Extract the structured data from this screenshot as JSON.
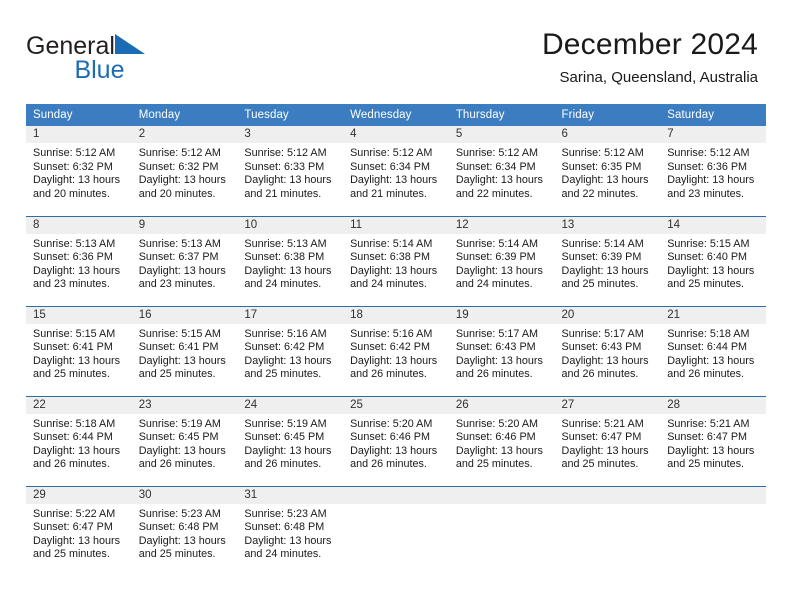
{
  "brand": {
    "name_part1": "General",
    "name_part2": "Blue",
    "flag_icon": "triangle-flag-icon"
  },
  "header": {
    "title": "December 2024",
    "location": "Sarina, Queensland, Australia"
  },
  "colors": {
    "header_blue": "#3b7dc0",
    "row_divider_blue": "#2e6da4",
    "daynum_band": "#efefef",
    "brand_blue": "#1c6cb5"
  },
  "calendar": {
    "weekday_headers": [
      "Sunday",
      "Monday",
      "Tuesday",
      "Wednesday",
      "Thursday",
      "Friday",
      "Saturday"
    ],
    "weeks": [
      [
        {
          "day": "1",
          "sunrise": "Sunrise: 5:12 AM",
          "sunset": "Sunset: 6:32 PM",
          "daylight_line1": "Daylight: 13 hours",
          "daylight_line2": "and 20 minutes."
        },
        {
          "day": "2",
          "sunrise": "Sunrise: 5:12 AM",
          "sunset": "Sunset: 6:32 PM",
          "daylight_line1": "Daylight: 13 hours",
          "daylight_line2": "and 20 minutes."
        },
        {
          "day": "3",
          "sunrise": "Sunrise: 5:12 AM",
          "sunset": "Sunset: 6:33 PM",
          "daylight_line1": "Daylight: 13 hours",
          "daylight_line2": "and 21 minutes."
        },
        {
          "day": "4",
          "sunrise": "Sunrise: 5:12 AM",
          "sunset": "Sunset: 6:34 PM",
          "daylight_line1": "Daylight: 13 hours",
          "daylight_line2": "and 21 minutes."
        },
        {
          "day": "5",
          "sunrise": "Sunrise: 5:12 AM",
          "sunset": "Sunset: 6:34 PM",
          "daylight_line1": "Daylight: 13 hours",
          "daylight_line2": "and 22 minutes."
        },
        {
          "day": "6",
          "sunrise": "Sunrise: 5:12 AM",
          "sunset": "Sunset: 6:35 PM",
          "daylight_line1": "Daylight: 13 hours",
          "daylight_line2": "and 22 minutes."
        },
        {
          "day": "7",
          "sunrise": "Sunrise: 5:12 AM",
          "sunset": "Sunset: 6:36 PM",
          "daylight_line1": "Daylight: 13 hours",
          "daylight_line2": "and 23 minutes."
        }
      ],
      [
        {
          "day": "8",
          "sunrise": "Sunrise: 5:13 AM",
          "sunset": "Sunset: 6:36 PM",
          "daylight_line1": "Daylight: 13 hours",
          "daylight_line2": "and 23 minutes."
        },
        {
          "day": "9",
          "sunrise": "Sunrise: 5:13 AM",
          "sunset": "Sunset: 6:37 PM",
          "daylight_line1": "Daylight: 13 hours",
          "daylight_line2": "and 23 minutes."
        },
        {
          "day": "10",
          "sunrise": "Sunrise: 5:13 AM",
          "sunset": "Sunset: 6:38 PM",
          "daylight_line1": "Daylight: 13 hours",
          "daylight_line2": "and 24 minutes."
        },
        {
          "day": "11",
          "sunrise": "Sunrise: 5:14 AM",
          "sunset": "Sunset: 6:38 PM",
          "daylight_line1": "Daylight: 13 hours",
          "daylight_line2": "and 24 minutes."
        },
        {
          "day": "12",
          "sunrise": "Sunrise: 5:14 AM",
          "sunset": "Sunset: 6:39 PM",
          "daylight_line1": "Daylight: 13 hours",
          "daylight_line2": "and 24 minutes."
        },
        {
          "day": "13",
          "sunrise": "Sunrise: 5:14 AM",
          "sunset": "Sunset: 6:39 PM",
          "daylight_line1": "Daylight: 13 hours",
          "daylight_line2": "and 25 minutes."
        },
        {
          "day": "14",
          "sunrise": "Sunrise: 5:15 AM",
          "sunset": "Sunset: 6:40 PM",
          "daylight_line1": "Daylight: 13 hours",
          "daylight_line2": "and 25 minutes."
        }
      ],
      [
        {
          "day": "15",
          "sunrise": "Sunrise: 5:15 AM",
          "sunset": "Sunset: 6:41 PM",
          "daylight_line1": "Daylight: 13 hours",
          "daylight_line2": "and 25 minutes."
        },
        {
          "day": "16",
          "sunrise": "Sunrise: 5:15 AM",
          "sunset": "Sunset: 6:41 PM",
          "daylight_line1": "Daylight: 13 hours",
          "daylight_line2": "and 25 minutes."
        },
        {
          "day": "17",
          "sunrise": "Sunrise: 5:16 AM",
          "sunset": "Sunset: 6:42 PM",
          "daylight_line1": "Daylight: 13 hours",
          "daylight_line2": "and 25 minutes."
        },
        {
          "day": "18",
          "sunrise": "Sunrise: 5:16 AM",
          "sunset": "Sunset: 6:42 PM",
          "daylight_line1": "Daylight: 13 hours",
          "daylight_line2": "and 26 minutes."
        },
        {
          "day": "19",
          "sunrise": "Sunrise: 5:17 AM",
          "sunset": "Sunset: 6:43 PM",
          "daylight_line1": "Daylight: 13 hours",
          "daylight_line2": "and 26 minutes."
        },
        {
          "day": "20",
          "sunrise": "Sunrise: 5:17 AM",
          "sunset": "Sunset: 6:43 PM",
          "daylight_line1": "Daylight: 13 hours",
          "daylight_line2": "and 26 minutes."
        },
        {
          "day": "21",
          "sunrise": "Sunrise: 5:18 AM",
          "sunset": "Sunset: 6:44 PM",
          "daylight_line1": "Daylight: 13 hours",
          "daylight_line2": "and 26 minutes."
        }
      ],
      [
        {
          "day": "22",
          "sunrise": "Sunrise: 5:18 AM",
          "sunset": "Sunset: 6:44 PM",
          "daylight_line1": "Daylight: 13 hours",
          "daylight_line2": "and 26 minutes."
        },
        {
          "day": "23",
          "sunrise": "Sunrise: 5:19 AM",
          "sunset": "Sunset: 6:45 PM",
          "daylight_line1": "Daylight: 13 hours",
          "daylight_line2": "and 26 minutes."
        },
        {
          "day": "24",
          "sunrise": "Sunrise: 5:19 AM",
          "sunset": "Sunset: 6:45 PM",
          "daylight_line1": "Daylight: 13 hours",
          "daylight_line2": "and 26 minutes."
        },
        {
          "day": "25",
          "sunrise": "Sunrise: 5:20 AM",
          "sunset": "Sunset: 6:46 PM",
          "daylight_line1": "Daylight: 13 hours",
          "daylight_line2": "and 26 minutes."
        },
        {
          "day": "26",
          "sunrise": "Sunrise: 5:20 AM",
          "sunset": "Sunset: 6:46 PM",
          "daylight_line1": "Daylight: 13 hours",
          "daylight_line2": "and 25 minutes."
        },
        {
          "day": "27",
          "sunrise": "Sunrise: 5:21 AM",
          "sunset": "Sunset: 6:47 PM",
          "daylight_line1": "Daylight: 13 hours",
          "daylight_line2": "and 25 minutes."
        },
        {
          "day": "28",
          "sunrise": "Sunrise: 5:21 AM",
          "sunset": "Sunset: 6:47 PM",
          "daylight_line1": "Daylight: 13 hours",
          "daylight_line2": "and 25 minutes."
        }
      ],
      [
        {
          "day": "29",
          "sunrise": "Sunrise: 5:22 AM",
          "sunset": "Sunset: 6:47 PM",
          "daylight_line1": "Daylight: 13 hours",
          "daylight_line2": "and 25 minutes."
        },
        {
          "day": "30",
          "sunrise": "Sunrise: 5:23 AM",
          "sunset": "Sunset: 6:48 PM",
          "daylight_line1": "Daylight: 13 hours",
          "daylight_line2": "and 25 minutes."
        },
        {
          "day": "31",
          "sunrise": "Sunrise: 5:23 AM",
          "sunset": "Sunset: 6:48 PM",
          "daylight_line1": "Daylight: 13 hours",
          "daylight_line2": "and 24 minutes."
        },
        {
          "day": "",
          "sunrise": "",
          "sunset": "",
          "daylight_line1": "",
          "daylight_line2": ""
        },
        {
          "day": "",
          "sunrise": "",
          "sunset": "",
          "daylight_line1": "",
          "daylight_line2": ""
        },
        {
          "day": "",
          "sunrise": "",
          "sunset": "",
          "daylight_line1": "",
          "daylight_line2": ""
        },
        {
          "day": "",
          "sunrise": "",
          "sunset": "",
          "daylight_line1": "",
          "daylight_line2": ""
        }
      ]
    ]
  }
}
